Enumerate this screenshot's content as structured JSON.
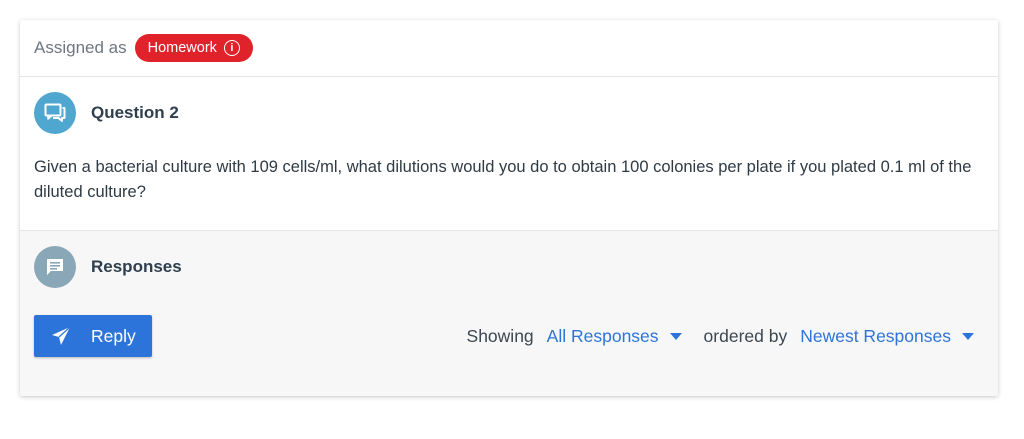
{
  "assignment": {
    "label": "Assigned as",
    "badge": "Homework"
  },
  "question": {
    "title": "Question 2",
    "text": "Given a bacterial culture with 109 cells/ml, what dilutions would you do to obtain 100 colonies per plate if you plated 0.1 ml of the diluted culture?"
  },
  "responses": {
    "title": "Responses",
    "reply_label": "Reply",
    "showing_label": "Showing",
    "showing_value": "All Responses",
    "ordered_label": "ordered by",
    "ordered_value": "Newest Responses"
  },
  "colors": {
    "accent": "#2d74da",
    "badge": "#e0232b",
    "question_avatar": "#4fa6cf",
    "responses_avatar": "#8aa7b7"
  },
  "icons": {
    "question": "chat-bubbles-icon",
    "responses": "comment-icon",
    "reply": "paper-plane-icon",
    "info": "info-icon",
    "dropdown": "caret-down-icon"
  }
}
